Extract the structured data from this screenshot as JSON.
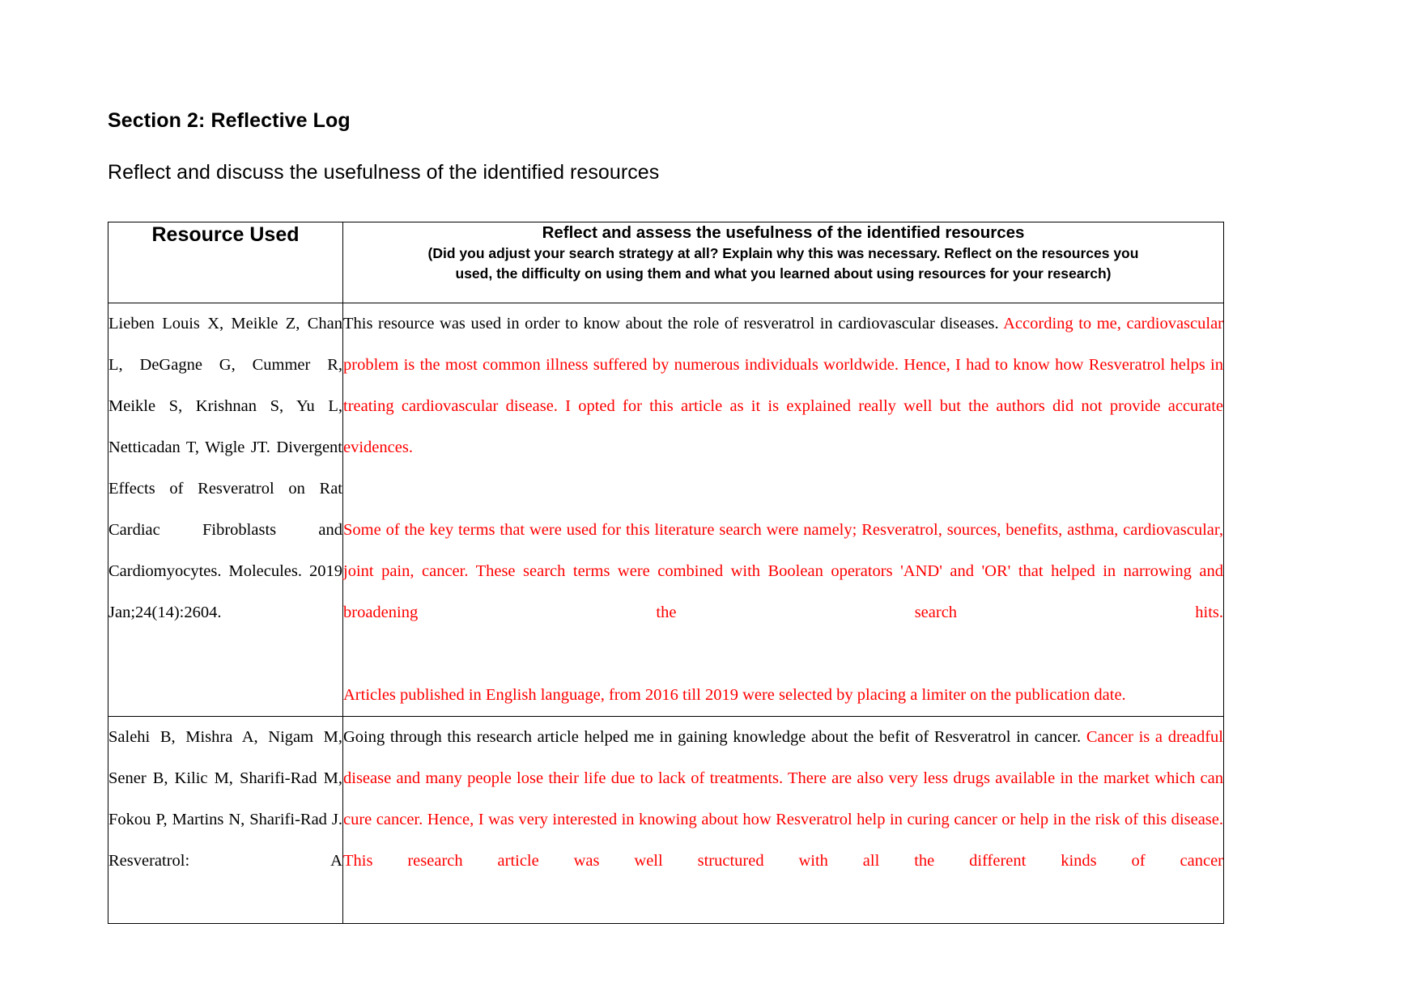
{
  "document": {
    "section_title": "Section 2: Reflective Log",
    "section_subtitle": "Reflect and discuss the usefulness of the identified resources"
  },
  "table": {
    "headers": {
      "resource_used": "Resource Used",
      "reflect_title": "Reflect and assess the usefulness of the identified resources",
      "reflect_subtitle_line1": "(Did you adjust your search strategy at all?  Explain why this was necessary.  Reflect on the resources you",
      "reflect_subtitle_line2": "used, the difficulty on using them and what you learned about using resources for your research)"
    },
    "colors": {
      "commentary_red": "#FF0000",
      "body_black": "#000000",
      "border": "#000000"
    },
    "rows": [
      {
        "resource": "Lieben Louis X, Meikle Z, Chan L, DeGagne G, Cummer R, Meikle S, Krishnan S, Yu L, Netticadan T, Wigle JT. Divergent Effects of Resveratrol on Rat Cardiac Fibroblasts and Cardiomyocytes. Molecules. 2019 Jan;24(14):2604.",
        "reflection_paragraphs": [
          {
            "segments": [
              {
                "color": "black",
                "text": "This resource was used in order to know about the role of resveratrol in cardiovascular diseases. "
              },
              {
                "color": "red",
                "text": "According to me, cardiovascular problem is the most common illness suffered by numerous individuals worldwide. Hence, I had to know how Resveratrol helps in treating cardiovascular disease. I opted for this article as it is explained really well but the authors did not provide accurate evidences."
              }
            ]
          },
          {
            "segments": [
              {
                "color": "red",
                "text": "Some of the key terms that were used for this literature search were namely; Resveratrol, sources, benefits, asthma, cardiovascular, joint pain, cancer. These search terms were combined with Boolean operators 'AND' and 'OR' that helped in narrowing and broadening the search hits."
              }
            ]
          },
          {
            "segments": [
              {
                "color": "red",
                "text": "Articles published in English language, from 2016 till 2019 were selected by placing a limiter on the publication date."
              }
            ]
          }
        ]
      },
      {
        "resource": "Salehi B, Mishra A, Nigam M, Sener B, Kilic M, Sharifi-Rad M, Fokou P, Martins N, Sharifi-Rad J. Resveratrol: A",
        "reflection_paragraphs": [
          {
            "segments": [
              {
                "color": "black",
                "text": "Going through this research article helped me in gaining knowledge about the befit of Resveratrol in cancer. "
              },
              {
                "color": "red",
                "text": "Cancer is a dreadful disease and many people lose their life due to lack of treatments. There are also very less drugs available in the market which can cure cancer. Hence, I was very interested in knowing about how Resveratrol help in curing cancer or help in the risk of this disease. This research article was well structured with all the different kinds of cancer"
              }
            ]
          }
        ]
      }
    ]
  }
}
